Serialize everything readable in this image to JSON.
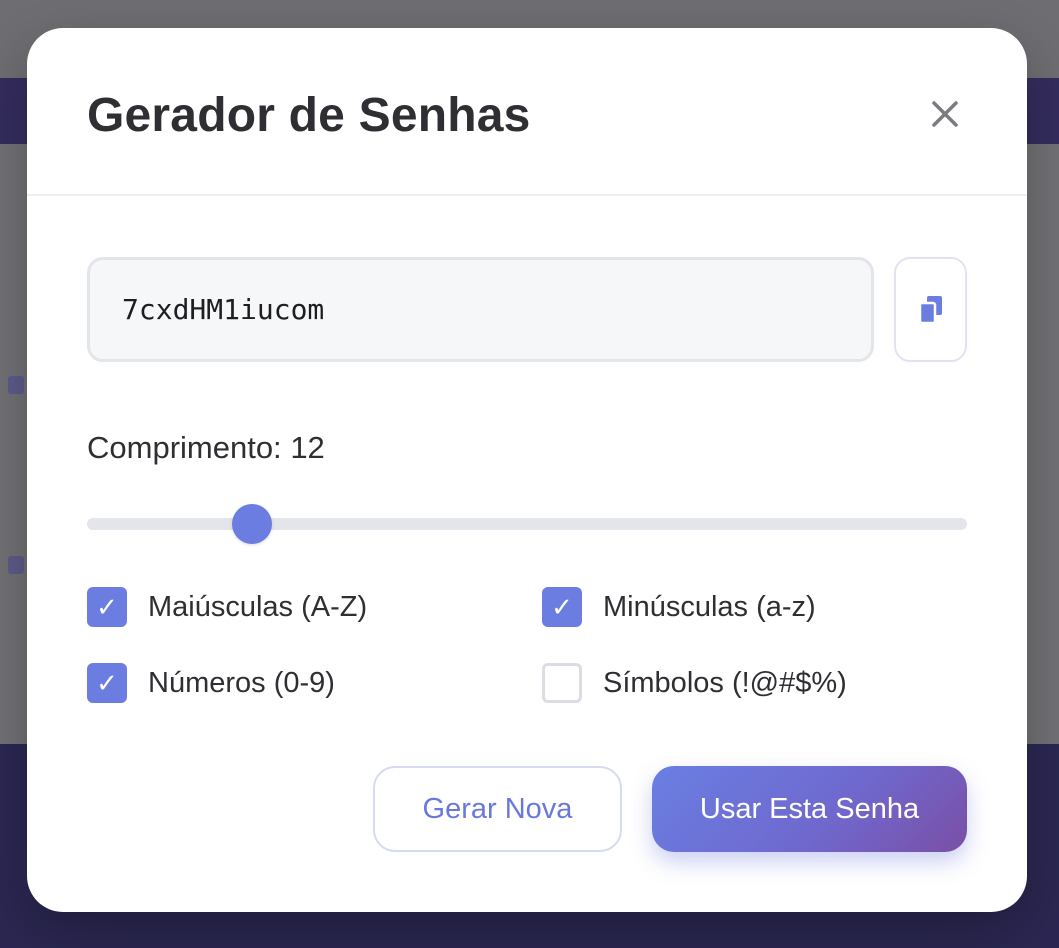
{
  "dialog": {
    "title": "Gerador de Senhas",
    "close_icon": "close-icon"
  },
  "password": {
    "value": "7cxdHM1iucom",
    "copy_icon": "copy-icon"
  },
  "length": {
    "label": "Comprimento:",
    "value": "12",
    "slider_fraction": 0.188
  },
  "options": [
    {
      "label": "Maiúsculas (A-Z)",
      "checked": true
    },
    {
      "label": "Minúsculas (a-z)",
      "checked": true
    },
    {
      "label": "Números (0-9)",
      "checked": true
    },
    {
      "label": "Símbolos (!@#$%)",
      "checked": false
    }
  ],
  "check_glyph": "✓",
  "buttons": {
    "generate": "Gerar Nova",
    "use": "Usar Esta Senha"
  },
  "colors": {
    "accent": "#6b7de0",
    "primary_gradient_end": "#7a4fa6",
    "title_text": "#2f2f33"
  }
}
